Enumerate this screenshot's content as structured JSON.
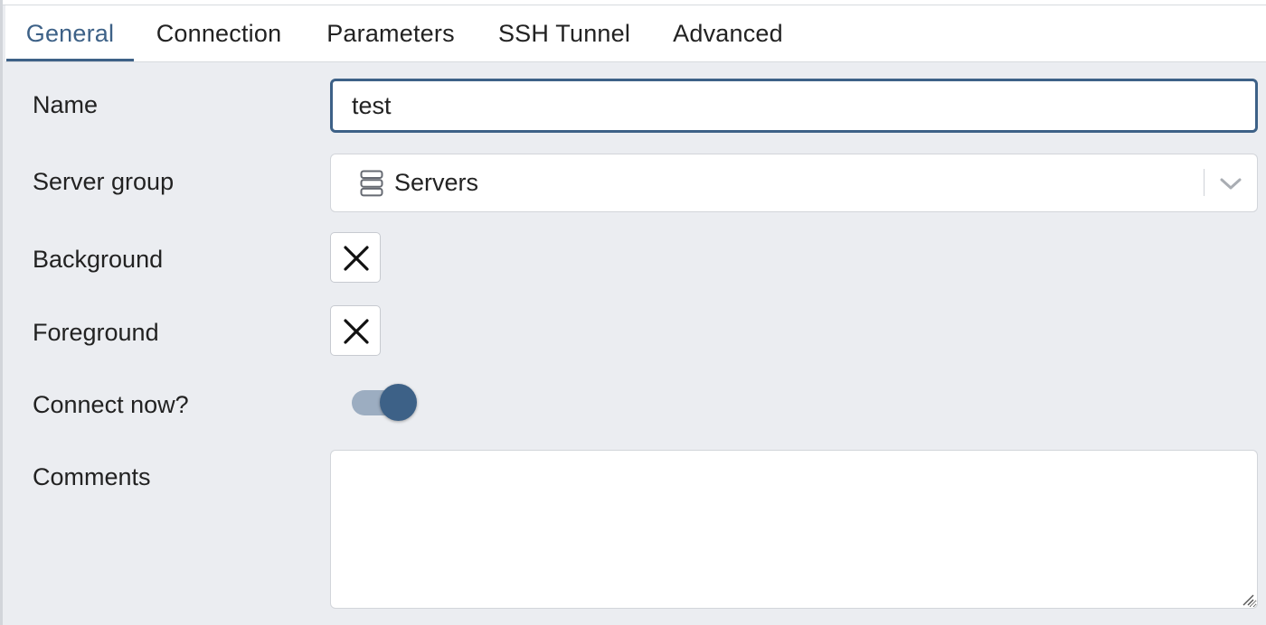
{
  "tabs": [
    {
      "label": "General",
      "active": true
    },
    {
      "label": "Connection",
      "active": false
    },
    {
      "label": "Parameters",
      "active": false
    },
    {
      "label": "SSH Tunnel",
      "active": false
    },
    {
      "label": "Advanced",
      "active": false
    }
  ],
  "form": {
    "name": {
      "label": "Name",
      "value": "test"
    },
    "server_group": {
      "label": "Server group",
      "value": "Servers",
      "icon": "server-group-icon"
    },
    "background": {
      "label": "Background",
      "icon": "clear-x-icon"
    },
    "foreground": {
      "label": "Foreground",
      "icon": "clear-x-icon"
    },
    "connect_now": {
      "label": "Connect now?",
      "checked": true
    },
    "comments": {
      "label": "Comments",
      "value": ""
    }
  },
  "colors": {
    "accent": "#3d6187",
    "background": "#ebedf1",
    "toggle_track": "#9cadc1"
  }
}
